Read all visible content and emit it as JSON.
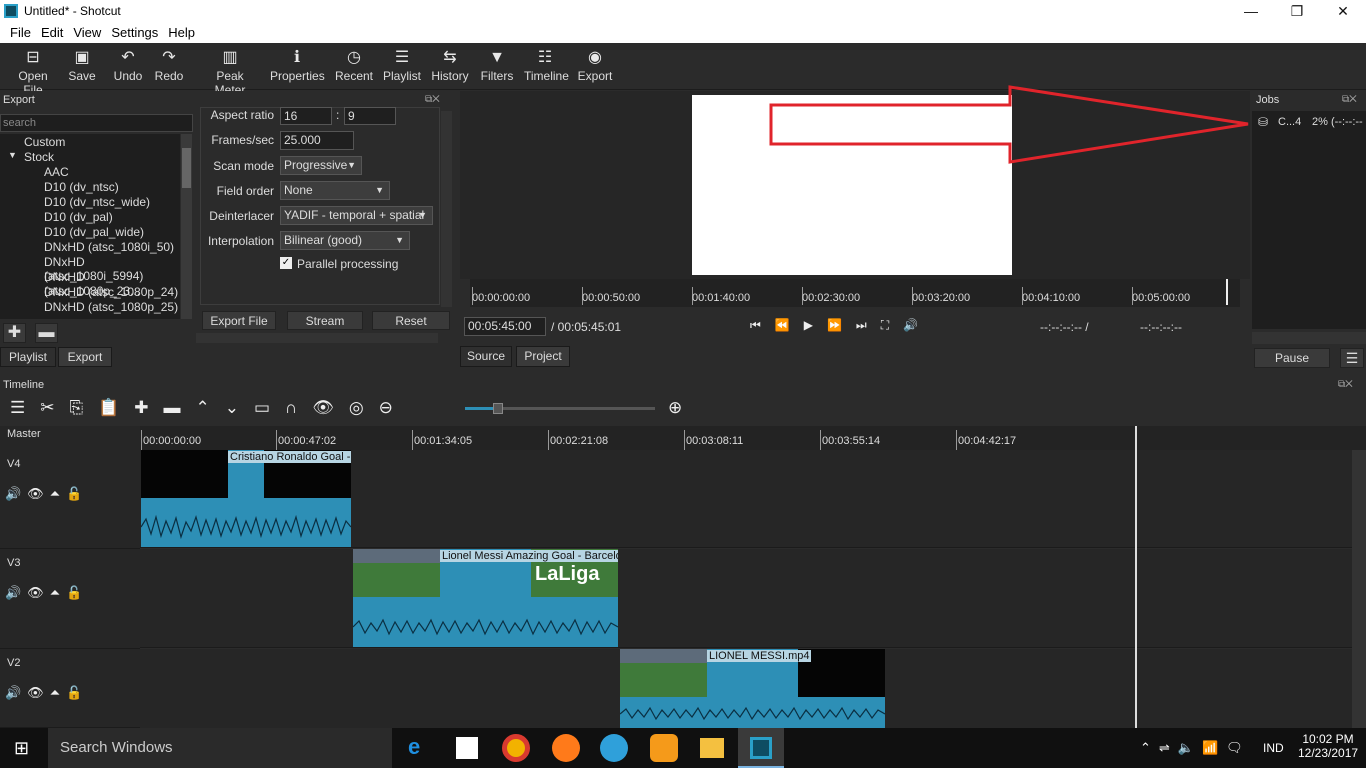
{
  "window": {
    "title": "Untitled* - Shotcut"
  },
  "menu": [
    "File",
    "Edit",
    "View",
    "Settings",
    "Help"
  ],
  "toolbar": [
    {
      "label": "Open File",
      "icon": "open-file-icon"
    },
    {
      "label": "Save",
      "icon": "save-icon"
    },
    {
      "label": "Undo",
      "icon": "undo-icon"
    },
    {
      "label": "Redo",
      "icon": "redo-icon"
    },
    {
      "label": "Peak Meter",
      "icon": "peak-meter-icon"
    },
    {
      "label": "Properties",
      "icon": "info-icon"
    },
    {
      "label": "Recent",
      "icon": "clock-icon"
    },
    {
      "label": "Playlist",
      "icon": "playlist-icon"
    },
    {
      "label": "History",
      "icon": "history-icon"
    },
    {
      "label": "Filters",
      "icon": "filter-icon"
    },
    {
      "label": "Timeline",
      "icon": "timeline-icon"
    },
    {
      "label": "Export",
      "icon": "export-icon"
    }
  ],
  "export_panel": {
    "title": "Export",
    "search_placeholder": "search",
    "groups": [
      "Custom",
      "Stock"
    ],
    "items": [
      "AAC",
      "D10 (dv_ntsc)",
      "D10 (dv_ntsc_wide)",
      "D10 (dv_pal)",
      "D10 (dv_pal_wide)",
      "DNxHD (atsc_1080i_50)",
      "DNxHD (atsc_1080i_5994)",
      "DNxHD (atsc_1080p_23...",
      "DNxHD (atsc_1080p_24)",
      "DNxHD (atsc_1080p_25)"
    ],
    "settings": {
      "aspect_label": "Aspect ratio",
      "aspect_w": "16",
      "aspect_sep": ":",
      "aspect_h": "9",
      "fps_label": "Frames/sec",
      "fps": "25.000",
      "scan_label": "Scan mode",
      "scan": "Progressive",
      "field_label": "Field order",
      "field": "None",
      "deint_label": "Deinterlacer",
      "deint": "YADIF - temporal + spatial",
      "interp_label": "Interpolation",
      "interp": "Bilinear (good)",
      "parallel_label": "Parallel processing",
      "parallel_checked": true
    },
    "buttons": {
      "export_file": "Export File",
      "stream": "Stream",
      "reset": "Reset"
    },
    "tabs": [
      "Playlist",
      "Export"
    ]
  },
  "player": {
    "ruler": [
      "00:00:00:00",
      "00:00:50:00",
      "00:01:40:00",
      "00:02:30:00",
      "00:03:20:00",
      "00:04:10:00",
      "00:05:00:00"
    ],
    "position": "00:05:45:00",
    "duration": "/ 00:05:45:01",
    "in_point": "--:--:--:-- /",
    "out_point": "--:--:--:--",
    "tabs": [
      "Source",
      "Project"
    ]
  },
  "jobs": {
    "title": "Jobs",
    "job_name": "C...4",
    "job_status": "2% (--:--:--",
    "pause": "Pause"
  },
  "timeline": {
    "title": "Timeline",
    "master": "Master",
    "ruler": [
      "00:00:00:00",
      "00:00:47:02",
      "00:01:34:05",
      "00:02:21:08",
      "00:03:08:11",
      "00:03:55:14",
      "00:04:42:17"
    ],
    "tracks": [
      {
        "name": "V4",
        "clip": "Cristiano Ronaldo Goal -"
      },
      {
        "name": "V3",
        "clip": "Lionel Messi Amazing Goal - Barcelor"
      },
      {
        "name": "V2",
        "clip": "LIONEL MESSI.mp4"
      }
    ],
    "laliga_text": "LaLiga"
  },
  "taskbar": {
    "search": "Search Windows",
    "lang": "IND",
    "time": "10:02 PM",
    "date": "12/23/2017"
  },
  "colors": {
    "accent_red": "#e0242b",
    "clip_blue": "#2d8fb6"
  }
}
